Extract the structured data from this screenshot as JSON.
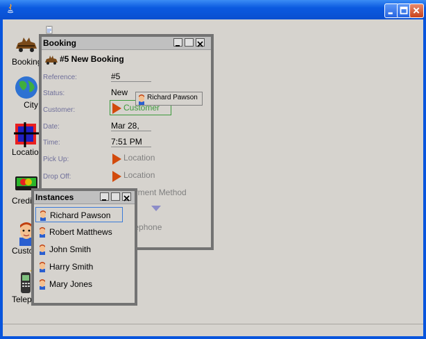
{
  "desktop_icons": [
    {
      "name": "booking",
      "label": "Booking",
      "icon": "car-icon"
    },
    {
      "name": "city",
      "label": "City",
      "icon": "globe-icon"
    },
    {
      "name": "location",
      "label": "Location",
      "icon": "map-pin-icon"
    },
    {
      "name": "credit-card",
      "label": "Credit Card",
      "icon": "credit-card-icon"
    },
    {
      "name": "customer",
      "label": "Customer",
      "icon": "person-icon"
    },
    {
      "name": "telephone",
      "label": "Telephone",
      "icon": "mobile-phone-icon"
    }
  ],
  "booking_window": {
    "title": "Booking",
    "heading": "#5 New Booking",
    "fields": {
      "reference": {
        "label": "Reference:",
        "value": "#5"
      },
      "status": {
        "label": "Status:",
        "value": "New"
      },
      "customer": {
        "label": "Customer:",
        "value": "Customer"
      },
      "date": {
        "label": "Date:",
        "value": "Mar 28,"
      },
      "time": {
        "label": "Time:",
        "value": "7:51 PM"
      },
      "pick_up": {
        "label": "Pick Up:",
        "value": "Location"
      },
      "drop_off": {
        "label": "Drop Off:",
        "value": "Location"
      },
      "payment": {
        "value": "Payment Method"
      },
      "telephone": {
        "value": "Telephone"
      }
    },
    "drag_label": "Richard Pawson"
  },
  "instances_window": {
    "title": "Instances",
    "items": [
      "Richard Pawson",
      "Robert Matthews",
      "John Smith",
      "Harry Smith",
      "Mary Jones"
    ],
    "selected_index": 0
  },
  "colors": {
    "titlebar": "#0b5ae0",
    "desktop": "#d6d3ce",
    "label_text": "#6f6f9a",
    "accent_green": "#3c9a3c",
    "arrow": "#d24a0c"
  }
}
